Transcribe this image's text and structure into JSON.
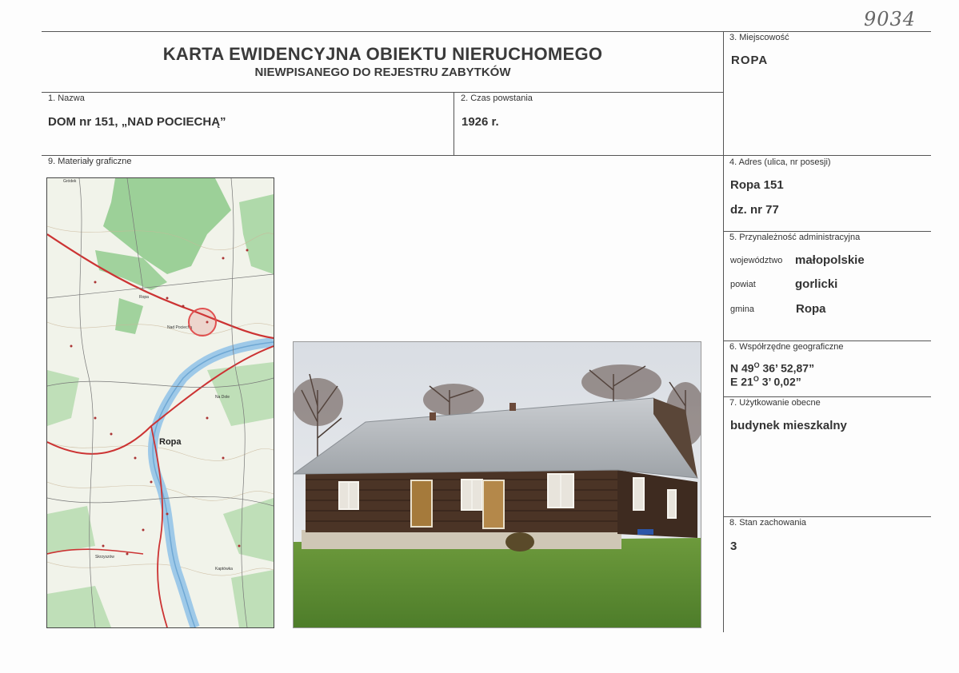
{
  "header": {
    "archive_number": "9034",
    "title": "KARTA EWIDENCYJNA OBIEKTU NIERUCHOMEGO",
    "subtitle": "NIEWPISANEGO DO REJESTRU ZABYTKÓW"
  },
  "fields": {
    "nazwa": {
      "label": "1. Nazwa",
      "value": "DOM nr 151, „NAD POCIECHĄ”"
    },
    "czas": {
      "label": "2. Czas powstania",
      "value": "1926 r."
    },
    "miejscowosc": {
      "label": "3. Miejscowość",
      "value": "ROPA"
    },
    "adres": {
      "label": "4. Adres (ulica, nr posesji)",
      "line1": "Ropa 151",
      "line2": "dz. nr 77"
    },
    "przynaleznosc": {
      "label": "5. Przynależność administracyjna",
      "wojewodztwo_label": "województwo",
      "wojewodztwo_value": "małopolskie",
      "powiat_label": "powiat",
      "powiat_value": "gorlicki",
      "gmina_label": "gmina",
      "gmina_value": "Ropa"
    },
    "wspolrzedne": {
      "label": "6. Współrzędne geograficzne",
      "n_prefix": "N 49",
      "n_deg": "O",
      "n_rest": " 36’ 52,87”",
      "e_prefix": "E 21",
      "e_deg": "O",
      "e_rest": " 3’ 0,02”"
    },
    "uzytkowanie": {
      "label": "7. Użytkowanie obecne",
      "value": "budynek mieszkalny"
    },
    "stan": {
      "label": "8. Stan zachowania",
      "value": "3"
    },
    "materialy": {
      "label": "9. Materiały graficzne"
    }
  },
  "map": {
    "town_label": "Ropa",
    "place_labels": [
      "Ropa",
      "Nad Pociechą",
      "Gródek",
      "Skrzyszów",
      "Na Dole",
      "Kaptówka"
    ],
    "colors": {
      "forest": "#8dc98a",
      "river": "#9ec9e8",
      "road": "#c33",
      "marker": "#e05050"
    }
  }
}
